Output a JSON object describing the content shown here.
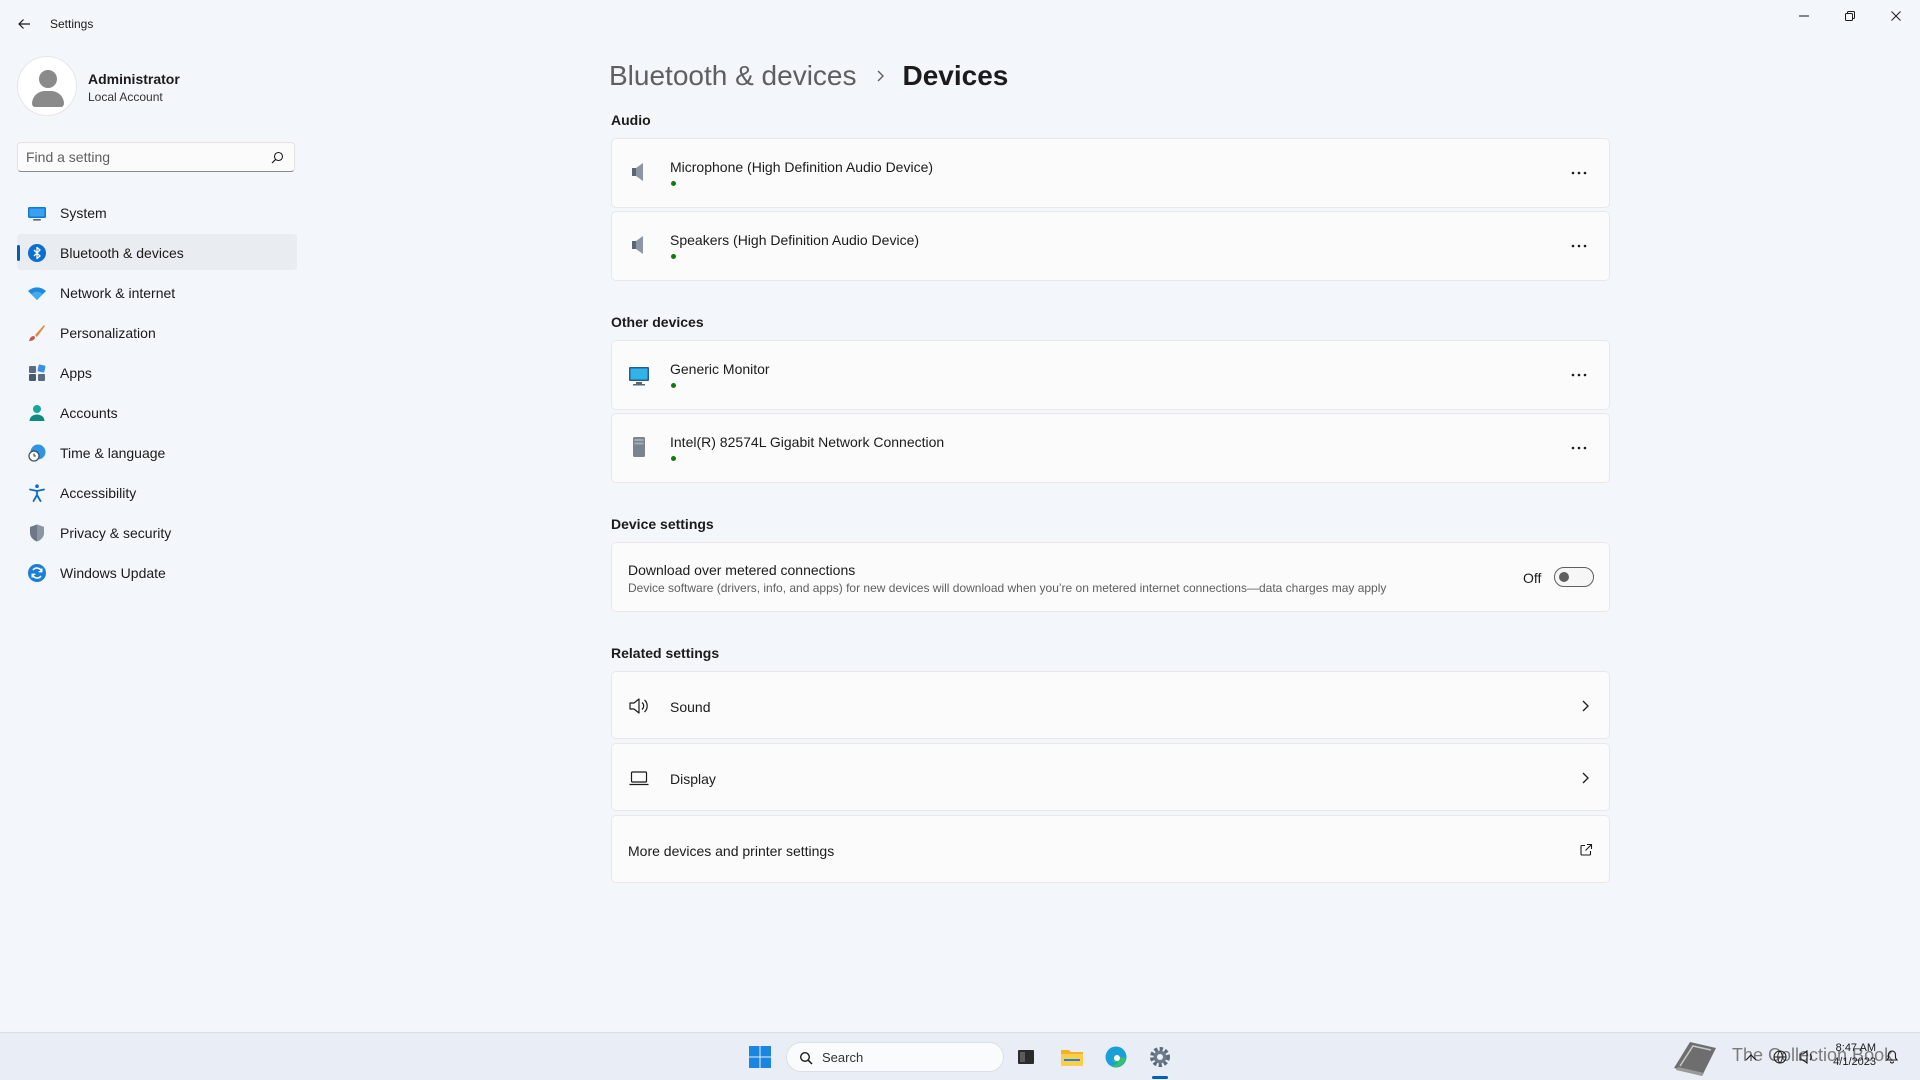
{
  "window": {
    "title": "Settings",
    "back_icon": "back-arrow-icon",
    "controls": [
      "minimize-icon",
      "restore-icon",
      "close-icon"
    ]
  },
  "profile": {
    "name": "Administrator",
    "account_type": "Local Account"
  },
  "search": {
    "placeholder": "Find a setting"
  },
  "sidebar": {
    "items": [
      {
        "label": "System",
        "icon": "system-icon",
        "active": false
      },
      {
        "label": "Bluetooth & devices",
        "icon": "bluetooth-icon",
        "active": true
      },
      {
        "label": "Network & internet",
        "icon": "wifi-icon",
        "active": false
      },
      {
        "label": "Personalization",
        "icon": "brush-icon",
        "active": false
      },
      {
        "label": "Apps",
        "icon": "apps-icon",
        "active": false
      },
      {
        "label": "Accounts",
        "icon": "accounts-icon",
        "active": false
      },
      {
        "label": "Time & language",
        "icon": "clock-globe-icon",
        "active": false
      },
      {
        "label": "Accessibility",
        "icon": "accessibility-icon",
        "active": false
      },
      {
        "label": "Privacy & security",
        "icon": "shield-icon",
        "active": false
      },
      {
        "label": "Windows Update",
        "icon": "update-icon",
        "active": false
      }
    ]
  },
  "breadcrumb": {
    "parent": "Bluetooth & devices",
    "current": "Devices"
  },
  "sections": {
    "audio": {
      "title": "Audio",
      "devices": [
        {
          "name": "Microphone (High Definition Audio Device)",
          "icon": "speaker-device-icon",
          "status": "connected"
        },
        {
          "name": "Speakers (High Definition Audio Device)",
          "icon": "speaker-device-icon",
          "status": "connected"
        }
      ]
    },
    "other": {
      "title": "Other devices",
      "devices": [
        {
          "name": "Generic Monitor",
          "icon": "monitor-icon",
          "status": "connected"
        },
        {
          "name": "Intel(R) 82574L Gigabit Network Connection",
          "icon": "network-device-icon",
          "status": "connected"
        }
      ]
    },
    "device_settings": {
      "title": "Device settings",
      "metered": {
        "title": "Download over metered connections",
        "description": "Device software (drivers, info, and apps) for new devices will download when you’re on metered internet connections—data charges may apply",
        "state_label": "Off",
        "enabled": false
      }
    },
    "related": {
      "title": "Related settings",
      "items": [
        {
          "label": "Sound",
          "icon": "sound-icon"
        },
        {
          "label": "Display",
          "icon": "laptop-icon"
        },
        {
          "label": "More devices and printer settings",
          "icon": "external-link-icon"
        }
      ]
    }
  },
  "taskbar": {
    "search_label": "Search",
    "apps": [
      "start-icon",
      "task-view-icon",
      "file-explorer-icon",
      "edge-icon",
      "settings-icon"
    ],
    "watermark": "The Collection Book",
    "time": "8:47 AM",
    "date": "4/1/2023"
  },
  "colors": {
    "accent": "#005fb8",
    "status_ok": "#0f7b0f",
    "background": "#f3f6fb",
    "card": "#fbfbfc"
  }
}
